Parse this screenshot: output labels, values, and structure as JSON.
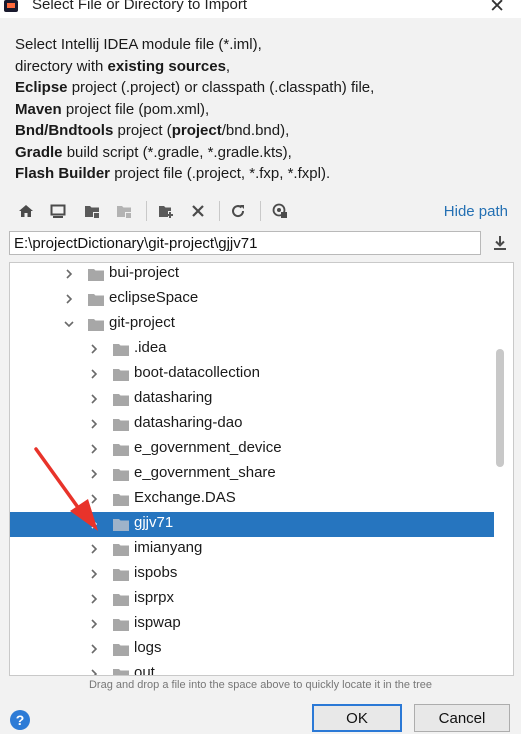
{
  "window": {
    "title": "Select File or Directory to Import",
    "close_glyph": "✕"
  },
  "description": [
    [
      {
        "t": "Select Intellij IDEA module file (*.iml),",
        "b": false
      }
    ],
    [
      {
        "t": "directory with ",
        "b": false
      },
      {
        "t": "existing sources",
        "b": true
      },
      {
        "t": ",",
        "b": false
      }
    ],
    [
      {
        "t": "Eclipse",
        "b": true
      },
      {
        "t": " project (.project) or classpath (.classpath) file,",
        "b": false
      }
    ],
    [
      {
        "t": "Maven",
        "b": true
      },
      {
        "t": " project file (pom.xml),",
        "b": false
      }
    ],
    [
      {
        "t": "Bnd/Bndtools",
        "b": true
      },
      {
        "t": " project (",
        "b": false
      },
      {
        "t": "project",
        "b": true
      },
      {
        "t": "/bnd.bnd),",
        "b": false
      }
    ],
    [
      {
        "t": "Gradle",
        "b": true
      },
      {
        "t": " build script (*.gradle, *.gradle.kts),",
        "b": false
      }
    ],
    [
      {
        "t": "Flash Builder",
        "b": true
      },
      {
        "t": " project file (.project, *.fxp, *.fxpl).",
        "b": false
      }
    ]
  ],
  "toolbar": {
    "icons": [
      "home-icon",
      "desktop-icon",
      "project-folder-icon",
      "module-folder-icon",
      "new-folder-icon",
      "delete-icon",
      "refresh-icon",
      "show-hidden-icon"
    ],
    "hide_path_label": "Hide path"
  },
  "path": {
    "value": "E:\\projectDictionary\\git-project\\gjjv71"
  },
  "tree": {
    "rows": [
      {
        "label": "bui-project",
        "depth": 0,
        "expanded": false,
        "selected": false
      },
      {
        "label": "eclipseSpace",
        "depth": 0,
        "expanded": false,
        "selected": false
      },
      {
        "label": "git-project",
        "depth": 0,
        "expanded": true,
        "selected": false
      },
      {
        "label": ".idea",
        "depth": 1,
        "expanded": false,
        "selected": false
      },
      {
        "label": "boot-datacollection",
        "depth": 1,
        "expanded": false,
        "selected": false
      },
      {
        "label": "datasharing",
        "depth": 1,
        "expanded": false,
        "selected": false
      },
      {
        "label": "datasharing-dao",
        "depth": 1,
        "expanded": false,
        "selected": false
      },
      {
        "label": "e_government_device",
        "depth": 1,
        "expanded": false,
        "selected": false
      },
      {
        "label": "e_government_share",
        "depth": 1,
        "expanded": false,
        "selected": false
      },
      {
        "label": "Exchange.DAS",
        "depth": 1,
        "expanded": false,
        "selected": false
      },
      {
        "label": "gjjv71",
        "depth": 1,
        "expanded": false,
        "selected": true
      },
      {
        "label": "imianyang",
        "depth": 1,
        "expanded": false,
        "selected": false
      },
      {
        "label": "ispobs",
        "depth": 1,
        "expanded": false,
        "selected": false
      },
      {
        "label": "isprpx",
        "depth": 1,
        "expanded": false,
        "selected": false
      },
      {
        "label": "ispwap",
        "depth": 1,
        "expanded": false,
        "selected": false
      },
      {
        "label": "logs",
        "depth": 1,
        "expanded": false,
        "selected": false
      },
      {
        "label": "out",
        "depth": 1,
        "expanded": false,
        "selected": false
      }
    ]
  },
  "hint": "Drag and drop a file into the space above to quickly locate it in the tree",
  "buttons": {
    "help": "?",
    "ok": "OK",
    "cancel": "Cancel"
  },
  "colors": {
    "selection": "#2675bf",
    "link": "#2470b3",
    "annotation_arrow": "#e8332a"
  }
}
